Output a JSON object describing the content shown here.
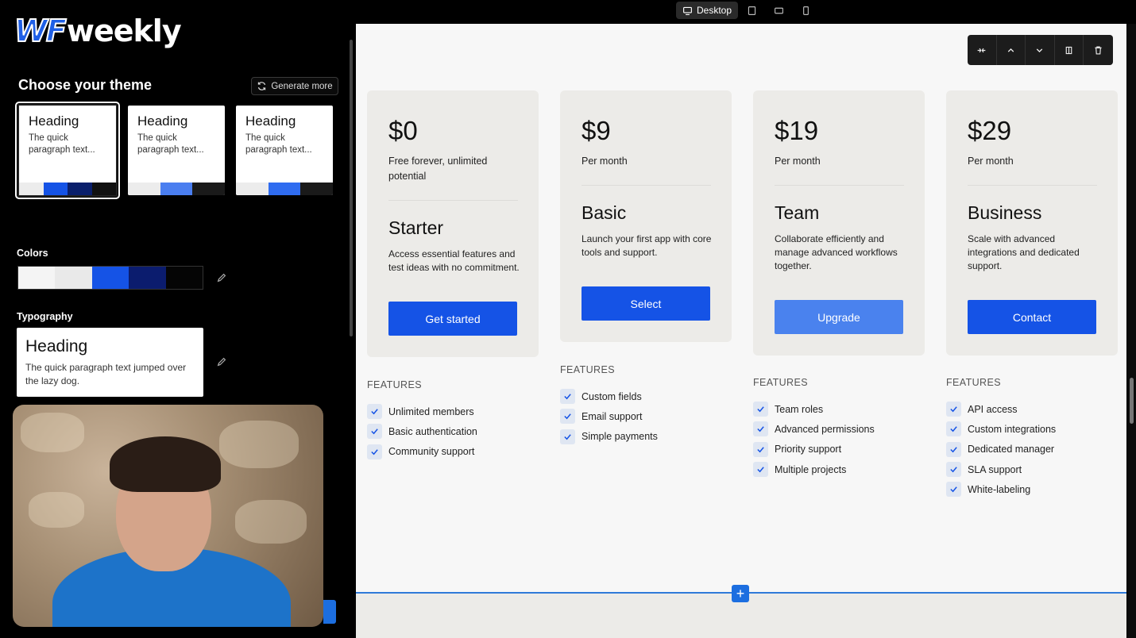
{
  "logo": {
    "wf": "WF",
    "weekly": "weekly"
  },
  "theme": {
    "title": "Choose your theme",
    "generate_label": "Generate more",
    "cards": [
      {
        "heading": "Heading",
        "paragraph": "The quick paragraph text...",
        "swatches": [
          "#ececec",
          "#1553e6",
          "#0a1f6b",
          "#111111"
        ]
      },
      {
        "heading": "Heading",
        "paragraph": "The quick paragraph text...",
        "swatches": [
          "#ececec",
          "#4a7ef0",
          "#1a1a1a"
        ]
      },
      {
        "heading": "Heading",
        "paragraph": "The quick paragraph text...",
        "swatches": [
          "#ececec",
          "#2f6cf0",
          "#1a1a1a"
        ]
      }
    ]
  },
  "colors": {
    "label": "Colors",
    "swatches": [
      "#f4f4f4",
      "#e9e9e9",
      "#1553e6",
      "#0b1c6e",
      "#050505"
    ]
  },
  "typography": {
    "label": "Typography",
    "heading": "Heading",
    "paragraph": "The quick paragraph text jumped over the lazy dog."
  },
  "device_bar": {
    "desktop_label": "Desktop"
  },
  "pricing": [
    {
      "price": "$0",
      "sub": "Free forever, unlimited potential",
      "name": "Starter",
      "desc": "Access essential features and test ideas with no commitment.",
      "cta": "Get started",
      "features_title": "FEATURES",
      "features": [
        "Unlimited members",
        "Basic authentication",
        "Community support"
      ]
    },
    {
      "price": "$9",
      "sub": "Per month",
      "name": "Basic",
      "desc": "Launch your first app with core tools and support.",
      "cta": "Select",
      "features_title": "FEATURES",
      "features": [
        "Custom fields",
        "Email support",
        "Simple payments"
      ]
    },
    {
      "price": "$19",
      "sub": "Per month",
      "name": "Team",
      "desc": "Collaborate efficiently and manage advanced workflows together.",
      "cta": "Upgrade",
      "features_title": "FEATURES",
      "features": [
        "Team roles",
        "Advanced permissions",
        "Priority support",
        "Multiple projects"
      ]
    },
    {
      "price": "$29",
      "sub": "Per month",
      "name": "Business",
      "desc": "Scale with advanced integrations and dedicated support.",
      "cta": "Contact",
      "features_title": "FEATURES",
      "features": [
        "API access",
        "Custom integrations",
        "Dedicated manager",
        "SLA support",
        "White-labeling"
      ]
    }
  ],
  "accent": "#1553e6",
  "add_section": "+"
}
